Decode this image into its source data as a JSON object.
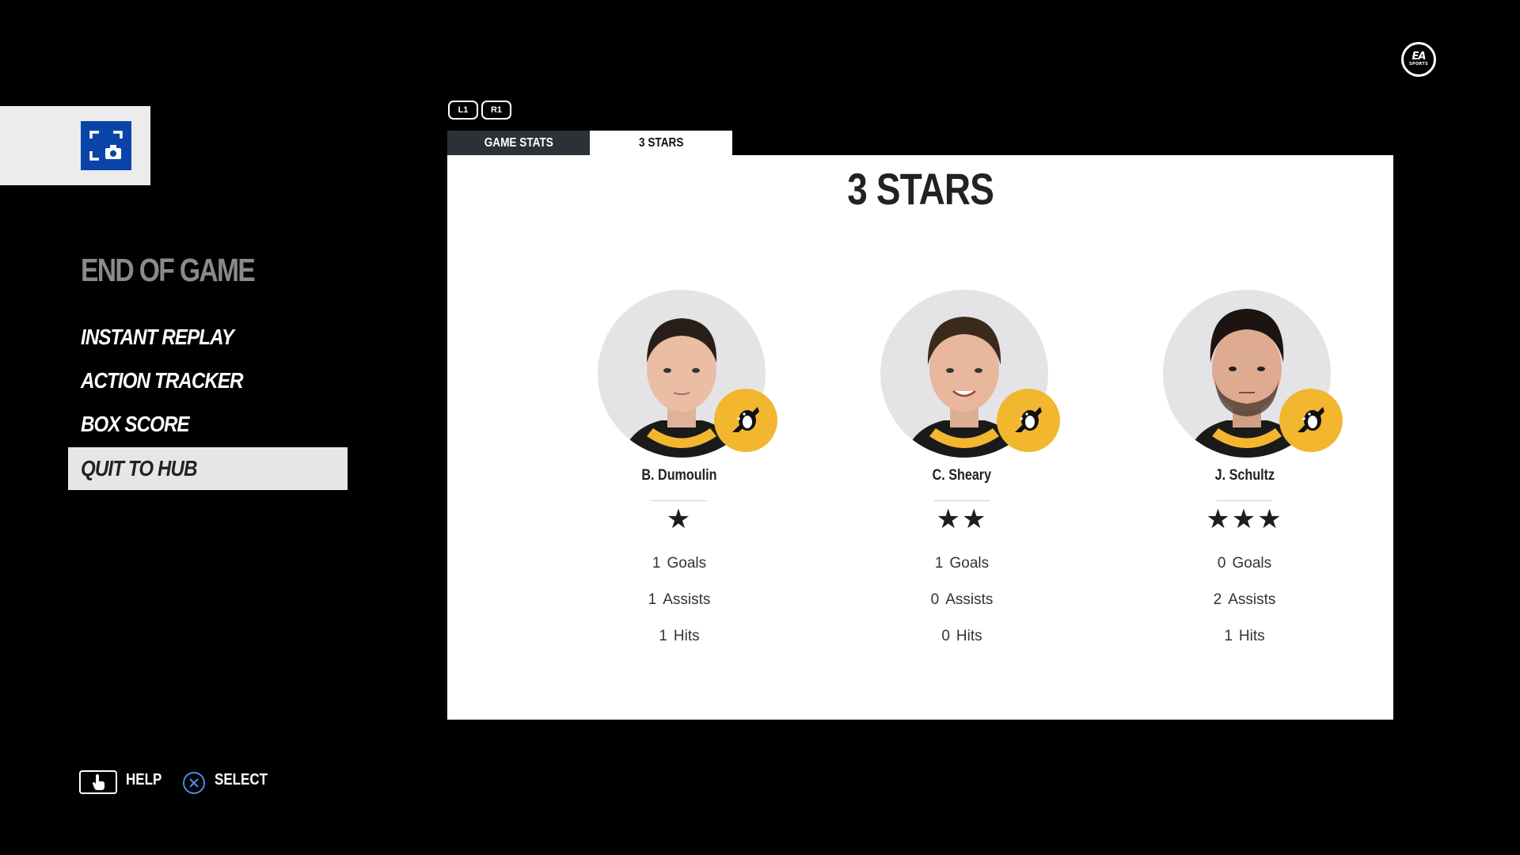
{
  "brand": {
    "logo_text": "EA",
    "logo_subtext": "SPORTS"
  },
  "capture": {
    "icon": "screenshot-camera-icon",
    "accent": "#0b44a8"
  },
  "menu": {
    "title": "END OF GAME",
    "items": [
      {
        "label": "INSTANT REPLAY",
        "selected": false
      },
      {
        "label": "ACTION TRACKER",
        "selected": false
      },
      {
        "label": "BOX SCORE",
        "selected": false
      },
      {
        "label": "QUIT TO HUB",
        "selected": true
      }
    ]
  },
  "bumpers": {
    "left": "L1",
    "right": "R1"
  },
  "tabs": [
    {
      "label": "GAME STATS",
      "active": false
    },
    {
      "label": "3 STARS",
      "active": true
    }
  ],
  "panel": {
    "title": "3 STARS",
    "players": [
      {
        "name": "B. Dumoulin",
        "stars": "★",
        "star_count": 1,
        "stats": [
          {
            "value": "1",
            "label": "Goals"
          },
          {
            "value": "1",
            "label": "Assists"
          },
          {
            "value": "1",
            "label": "Hits"
          }
        ],
        "team_icon": "penguins-logo-icon"
      },
      {
        "name": "C. Sheary",
        "stars": "★★",
        "star_count": 2,
        "stats": [
          {
            "value": "1",
            "label": "Goals"
          },
          {
            "value": "0",
            "label": "Assists"
          },
          {
            "value": "0",
            "label": "Hits"
          }
        ],
        "team_icon": "penguins-logo-icon"
      },
      {
        "name": "J. Schultz",
        "stars": "★★★",
        "star_count": 3,
        "stats": [
          {
            "value": "0",
            "label": "Goals"
          },
          {
            "value": "2",
            "label": "Assists"
          },
          {
            "value": "1",
            "label": "Hits"
          }
        ],
        "team_icon": "penguins-logo-icon"
      }
    ]
  },
  "footer": {
    "help_label": "HELP",
    "select_label": "SELECT"
  },
  "colors": {
    "team_gold": "#f2b62f",
    "panel_bg": "#ffffff",
    "tab_inactive": "#2c3138",
    "select_button": "#4b8de0"
  }
}
